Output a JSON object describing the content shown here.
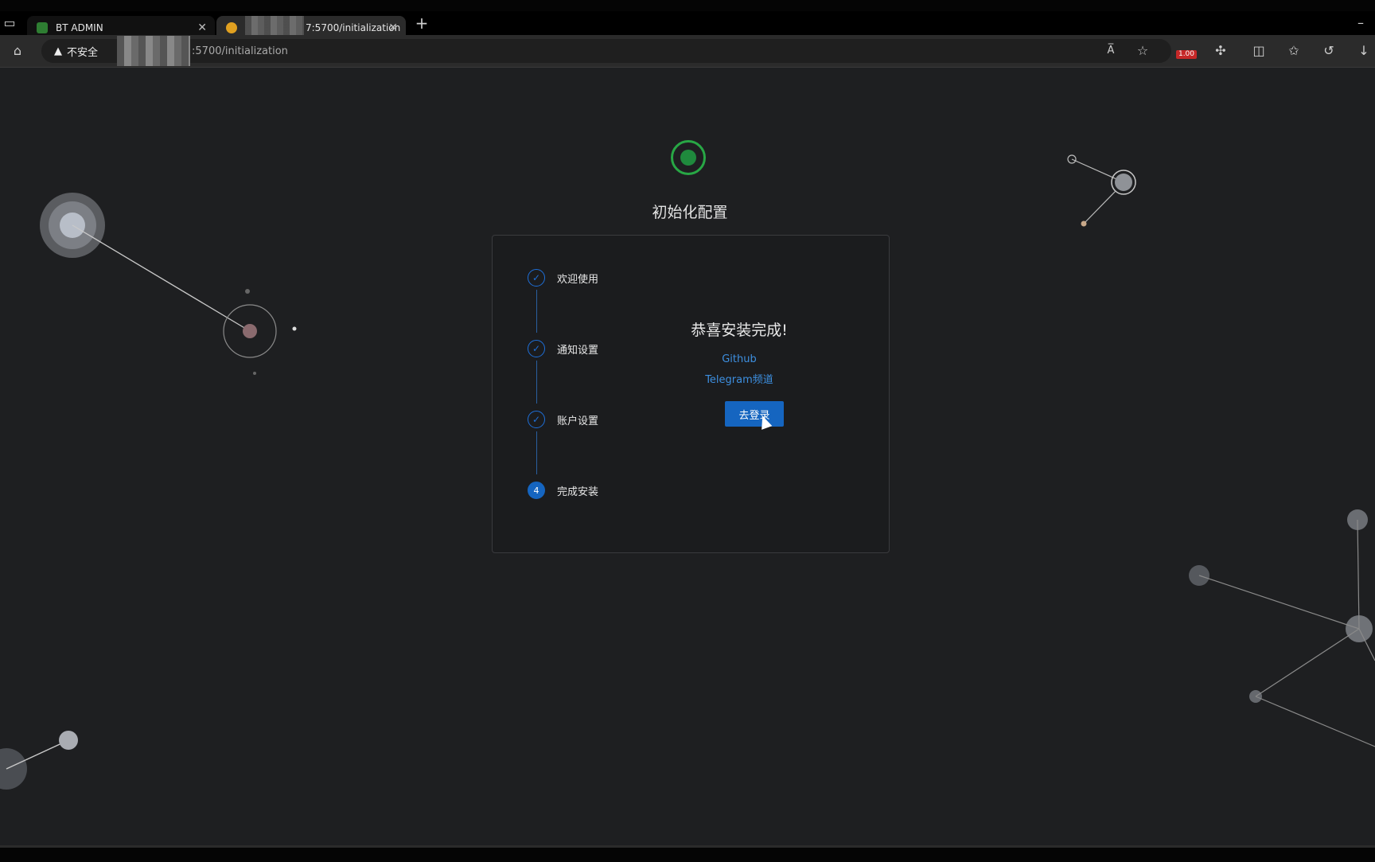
{
  "browser": {
    "tabs": [
      {
        "label": "BT ADMIN",
        "favicon": "shield-icon"
      },
      {
        "label": "7:5700/initialization",
        "favicon": "bt-icon"
      }
    ],
    "new_tab_symbol": "+",
    "security_label": "不安全",
    "url": ":5700/initialization",
    "read_aloud_icon": "A̅",
    "badge_value": "1.00"
  },
  "page": {
    "title": "初始化配置",
    "steps": [
      {
        "label": "欢迎使用",
        "status": "done",
        "icon": "✓"
      },
      {
        "label": "通知设置",
        "status": "done",
        "icon": "✓"
      },
      {
        "label": "账户设置",
        "status": "done",
        "icon": "✓"
      },
      {
        "label": "完成安装",
        "status": "active",
        "icon": "4"
      }
    ],
    "congrats": "恭喜安装完成!",
    "links": [
      "Github",
      "Telegram频道"
    ],
    "login_button": "去登录"
  },
  "colors": {
    "accent": "#1565c0",
    "link": "#3d8fe0",
    "logo": "#28a745",
    "background": "#1e1f21"
  }
}
